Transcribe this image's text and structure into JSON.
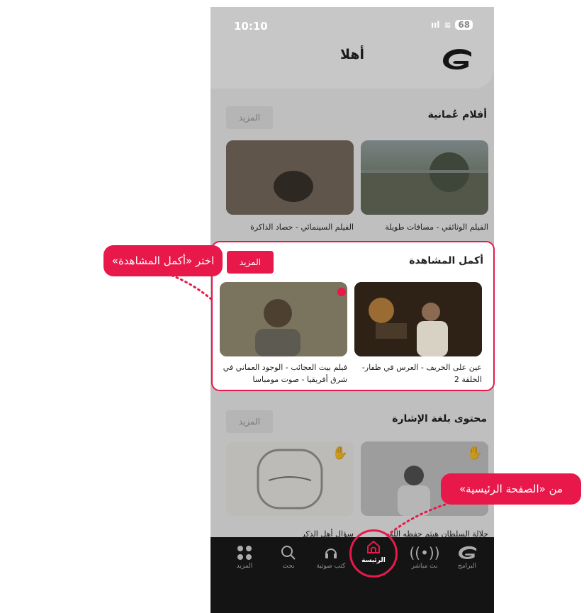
{
  "status": {
    "time": "10:10",
    "signal": "ııl",
    "wifi": "≋",
    "battery": "68"
  },
  "header": {
    "title": "أهلا"
  },
  "sections": [
    {
      "title": "أفلام عُمانية",
      "more": "المزيد",
      "items": [
        {
          "caption": "الفيلم الوثائقي - مسافات طويلة"
        },
        {
          "caption": "الفيلم السينمائي - حصاد الذاكرة"
        }
      ]
    },
    {
      "title": "أكمل المشاهدة",
      "more": "المزيد",
      "items": [
        {
          "caption": "عين على الخريف - العرس في ظفار- الحلقة 2"
        },
        {
          "caption": "فيلم بيت العجائب - الوجود العماني في شرق أفريقيا - صوت مومباسا"
        }
      ]
    },
    {
      "title": "محتوى بلغة الإشارة",
      "more": "المزيد",
      "items": [
        {
          "caption": "جلالة السلطان هيثم حفظه الله"
        },
        {
          "caption": "سؤال أهل الذكر"
        }
      ]
    }
  ],
  "tabs": [
    {
      "label": "البرامج",
      "icon": "logo-icon"
    },
    {
      "label": "بث مباشر",
      "icon": "live-icon"
    },
    {
      "label": "الرئيسة",
      "icon": "home-icon"
    },
    {
      "label": "كتب صوتية",
      "icon": "headphones-icon"
    },
    {
      "label": "بحث",
      "icon": "search-icon"
    },
    {
      "label": "المزيد",
      "icon": "grid-icon"
    }
  ],
  "callouts": {
    "continue": "اختر «أكمل المشاهدة»",
    "home": "من «الصفحة الرئيسية»"
  },
  "colors": {
    "accent": "#e8194a",
    "tabbar": "#1a1a1a"
  }
}
